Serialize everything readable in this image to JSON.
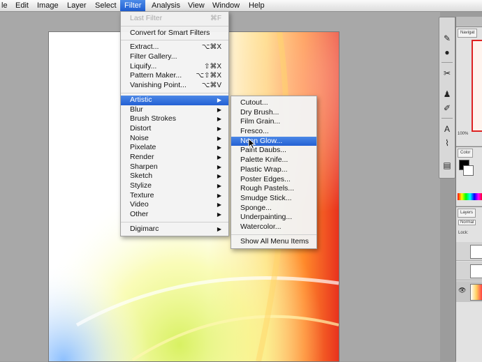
{
  "menubar": {
    "items": [
      {
        "label": "le",
        "active": false
      },
      {
        "label": "Edit",
        "active": false
      },
      {
        "label": "Image",
        "active": false
      },
      {
        "label": "Layer",
        "active": false
      },
      {
        "label": "Select",
        "active": false
      },
      {
        "label": "Filter",
        "active": true
      },
      {
        "label": "Analysis",
        "active": false
      },
      {
        "label": "View",
        "active": false
      },
      {
        "label": "Window",
        "active": false
      },
      {
        "label": "Help",
        "active": false
      }
    ]
  },
  "filter_menu": {
    "last_filter": {
      "label": "Last Filter",
      "shortcut": "⌘F"
    },
    "convert_smart": "Convert for Smart Filters",
    "group1": [
      {
        "label": "Extract...",
        "shortcut": "⌥⌘X"
      },
      {
        "label": "Filter Gallery...",
        "shortcut": ""
      },
      {
        "label": "Liquify...",
        "shortcut": "⇧⌘X"
      },
      {
        "label": "Pattern Maker...",
        "shortcut": "⌥⇧⌘X"
      },
      {
        "label": "Vanishing Point...",
        "shortcut": "⌥⌘V"
      }
    ],
    "submenus": [
      {
        "label": "Artistic",
        "highlighted": true
      },
      {
        "label": "Blur",
        "highlighted": false
      },
      {
        "label": "Brush Strokes",
        "highlighted": false
      },
      {
        "label": "Distort",
        "highlighted": false
      },
      {
        "label": "Noise",
        "highlighted": false
      },
      {
        "label": "Pixelate",
        "highlighted": false
      },
      {
        "label": "Render",
        "highlighted": false
      },
      {
        "label": "Sharpen",
        "highlighted": false
      },
      {
        "label": "Sketch",
        "highlighted": false
      },
      {
        "label": "Stylize",
        "highlighted": false
      },
      {
        "label": "Texture",
        "highlighted": false
      },
      {
        "label": "Video",
        "highlighted": false
      },
      {
        "label": "Other",
        "highlighted": false
      }
    ],
    "digimarc": "Digimarc",
    "arrow": "▶"
  },
  "artistic_menu": {
    "items": [
      {
        "label": "Cutout...",
        "highlighted": false
      },
      {
        "label": "Dry Brush...",
        "highlighted": false
      },
      {
        "label": "Film Grain...",
        "highlighted": false
      },
      {
        "label": "Fresco...",
        "highlighted": false
      },
      {
        "label": "Neon Glow...",
        "highlighted": true
      },
      {
        "label": "Paint Daubs...",
        "highlighted": false
      },
      {
        "label": "Palette Knife...",
        "highlighted": false
      },
      {
        "label": "Plastic Wrap...",
        "highlighted": false
      },
      {
        "label": "Poster Edges...",
        "highlighted": false
      },
      {
        "label": "Rough Pastels...",
        "highlighted": false
      },
      {
        "label": "Smudge Stick...",
        "highlighted": false
      },
      {
        "label": "Sponge...",
        "highlighted": false
      },
      {
        "label": "Underpainting...",
        "highlighted": false
      },
      {
        "label": "Watercolor...",
        "highlighted": false
      }
    ],
    "show_all": "Show All Menu Items"
  },
  "dock": {
    "navigator_tab": "Navigat",
    "zoom": "100%",
    "color_tab": "Color",
    "layers_tab": "Layers",
    "layers_blend": "Normal",
    "layers_lock": "Lock:"
  },
  "icons": {
    "tools": [
      "history-brush-icon",
      "dodge-icon",
      "crop-icon",
      "stamp-icon",
      "text-icon",
      "eyedropper-icon",
      "notes-icon"
    ]
  },
  "colors": {
    "highlight": "#2a66d6",
    "menubar_bg": "#e8e8e8",
    "canvas_bg": "#a8a8a8"
  }
}
